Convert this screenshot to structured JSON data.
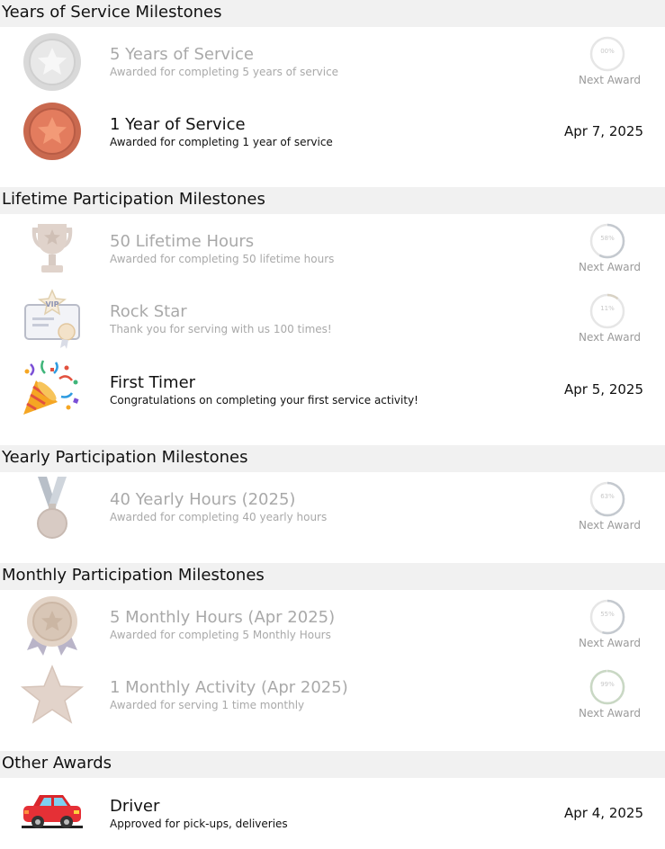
{
  "sections": {
    "service": {
      "title": "Years of Service Milestones"
    },
    "lifetime": {
      "title": "Lifetime Participation Milestones"
    },
    "yearly": {
      "title": "Yearly Participation Milestones"
    },
    "monthly": {
      "title": "Monthly Participation Milestones"
    },
    "other": {
      "title": "Other Awards"
    }
  },
  "awards": {
    "five_years": {
      "title": "5 Years of Service",
      "description": "Awarded for completing 5 years of service",
      "status": "Next Award",
      "progress_label": "00%",
      "progress_fraction": 0.0
    },
    "one_year": {
      "title": "1 Year of Service",
      "description": "Awarded for completing 1 year of service",
      "date": "Apr 7, 2025"
    },
    "fifty_hours": {
      "title": "50 Lifetime Hours",
      "description": "Awarded for completing 50 lifetime hours",
      "status": "Next Award",
      "progress_label": "58%",
      "progress_fraction": 0.58
    },
    "rock_star": {
      "title": "Rock Star",
      "description": "Thank you for serving with us 100 times!",
      "status": "Next Award",
      "progress_label": "11%",
      "progress_fraction": 0.11
    },
    "first_timer": {
      "title": "First Timer",
      "description": "Congratulations on completing your first service activity!",
      "date": "Apr 5, 2025"
    },
    "yearly_hours": {
      "title": "40 Yearly Hours (2025)",
      "description": "Awarded for completing 40 yearly hours",
      "status": "Next Award",
      "progress_label": "63%",
      "progress_fraction": 0.63
    },
    "monthly_hours": {
      "title": "5 Monthly Hours (Apr 2025)",
      "description": "Awarded for completing 5 Monthly Hours",
      "status": "Next Award",
      "progress_label": "55%",
      "progress_fraction": 0.55
    },
    "monthly_activity": {
      "title": "1 Monthly Activity (Apr 2025)",
      "description": "Awarded for serving 1 time monthly",
      "status": "Next Award",
      "progress_label": "99%",
      "progress_fraction": 0.99
    },
    "driver": {
      "title": "Driver",
      "description": "Approved for pick-ups, deliveries",
      "date": "Apr 4, 2025"
    }
  },
  "colors": {
    "section_background": "#f1f1f1",
    "locked_text": "#a9a9a9",
    "progress_track": "#e6e6e6",
    "progress_fill": "#c4c9cf",
    "progress_fill_complete": "#c9d8c4"
  },
  "icons": {
    "five_years": "silver-star-medal-icon",
    "one_year": "bronze-star-medal-icon",
    "fifty_hours": "trophy-icon",
    "rock_star": "vip-ticket-icon",
    "first_timer": "party-popper-icon",
    "yearly_hours": "ribbon-medal-icon",
    "monthly_hours": "rosette-badge-icon",
    "monthly_activity": "star-icon",
    "driver": "car-icon"
  }
}
